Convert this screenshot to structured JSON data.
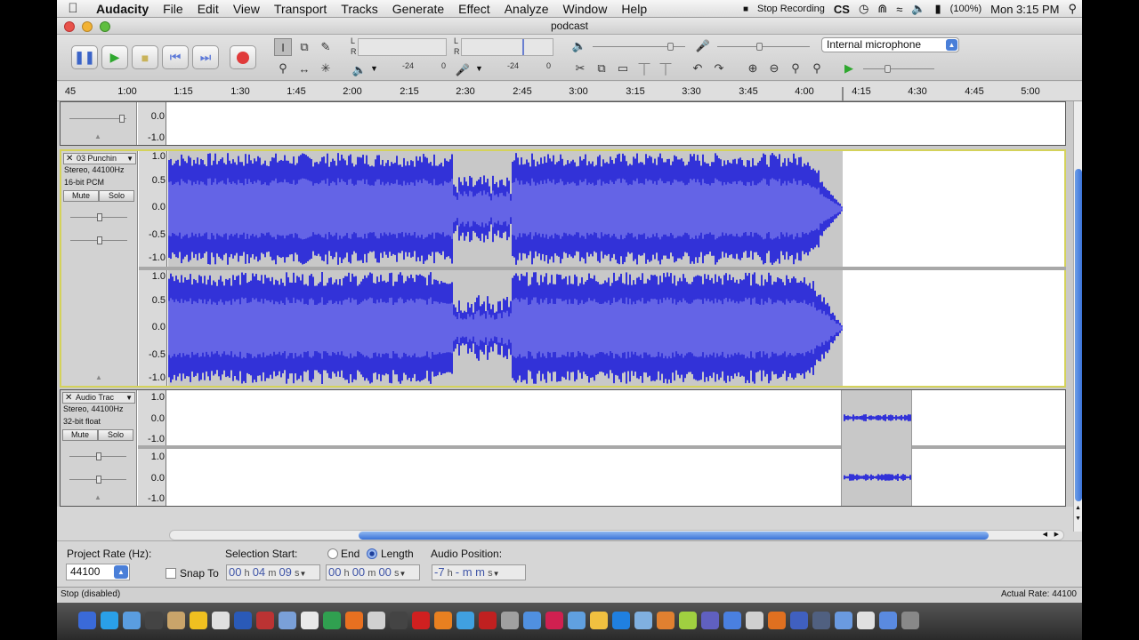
{
  "menubar": {
    "app_name": "Audacity",
    "items": [
      "File",
      "Edit",
      "View",
      "Transport",
      "Tracks",
      "Generate",
      "Effect",
      "Analyze",
      "Window",
      "Help"
    ],
    "status_items": {
      "stop_recording": "Stop Recording",
      "cs": "CS",
      "battery": "(100%)",
      "clock": "Mon 3:15 PM"
    }
  },
  "window": {
    "title": "podcast"
  },
  "toolbar": {
    "meter_labels": {
      "play_l": "L",
      "play_r": "R",
      "rec_l": "L",
      "rec_r": "R",
      "db1": "-24",
      "zero1": "0",
      "db2": "-24",
      "zero2": "0"
    },
    "input_device": "Internal microphone"
  },
  "ruler": {
    "ticks": [
      "45",
      "1:00",
      "1:15",
      "1:30",
      "1:45",
      "2:00",
      "2:15",
      "2:30",
      "2:45",
      "3:00",
      "3:15",
      "3:30",
      "3:45",
      "4:00",
      "4:15",
      "4:30",
      "4:45",
      "5:00"
    ]
  },
  "tracks": {
    "top_partial": {
      "labels": [
        "0.0",
        "-1.0"
      ]
    },
    "punchin": {
      "name": "03 Punchin",
      "format": "Stereo, 44100Hz",
      "bitdepth": "16-bit PCM",
      "mute": "Mute",
      "solo": "Solo",
      "labels": [
        "1.0",
        "0.5",
        "0.0",
        "-0.5",
        "-1.0"
      ]
    },
    "audio": {
      "name": "Audio Trac",
      "format": "Stereo, 44100Hz",
      "bitdepth": "32-bit float",
      "mute": "Mute",
      "solo": "Solo",
      "labels": [
        "1.0",
        "0.0",
        "-1.0"
      ]
    }
  },
  "selection_bar": {
    "project_rate_label": "Project Rate (Hz):",
    "project_rate": "44100",
    "snap_to": "Snap To",
    "selection_start_label": "Selection Start:",
    "end_label": "End",
    "length_label": "Length",
    "audio_position_label": "Audio Position:",
    "start": {
      "h": "00",
      "m": "04",
      "s": "09"
    },
    "length": {
      "h": "00",
      "m": "00",
      "s": "00"
    },
    "position": {
      "h": "-7",
      "m": "- m m"
    }
  },
  "status": {
    "left": "Stop (disabled)",
    "right": "Actual Rate: 44100"
  },
  "colors": {
    "waveform": "#3232d8",
    "waveform_light": "#6464e6",
    "selection_border": "#d4d25a",
    "scroll": "#3a72d8"
  }
}
